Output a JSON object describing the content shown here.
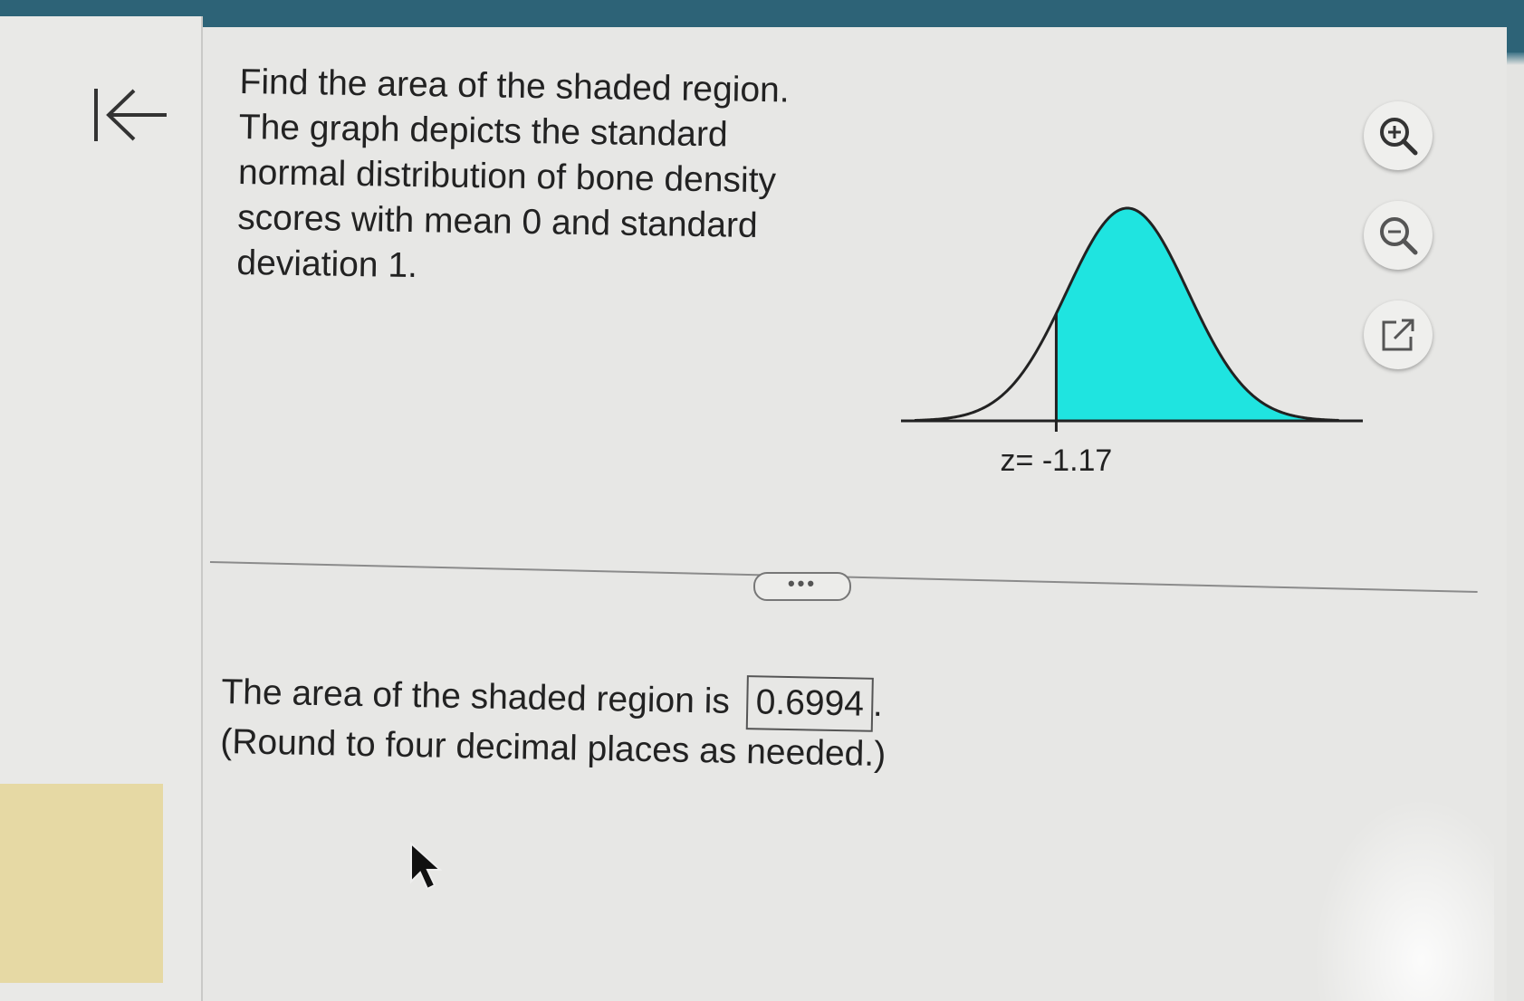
{
  "question": {
    "lines": [
      "Find the area of the shaded region.",
      "The graph depicts the standard",
      "normal distribution of bone density",
      "scores with mean 0 and standard",
      "deviation 1."
    ]
  },
  "chart_data": {
    "type": "area",
    "distribution": "standard normal",
    "mean": 0,
    "sd": 1,
    "shade_from_z": -1.17,
    "shade_direction": "right",
    "shade_color": "#1fe4e0",
    "tick_label": "z= -1.17",
    "xlim": [
      -3.5,
      3.5
    ]
  },
  "answer": {
    "prefix": "The area of the shaded region is",
    "value": "0.6994",
    "suffix": ".",
    "note": "(Round to four decimal places as needed.)"
  },
  "more_button": {
    "label": "•••"
  },
  "tools": [
    "zoom-in-icon",
    "zoom-out-icon",
    "external-link-icon"
  ],
  "colors": {
    "header": "#2d6377",
    "shade": "#1fe4e0"
  }
}
